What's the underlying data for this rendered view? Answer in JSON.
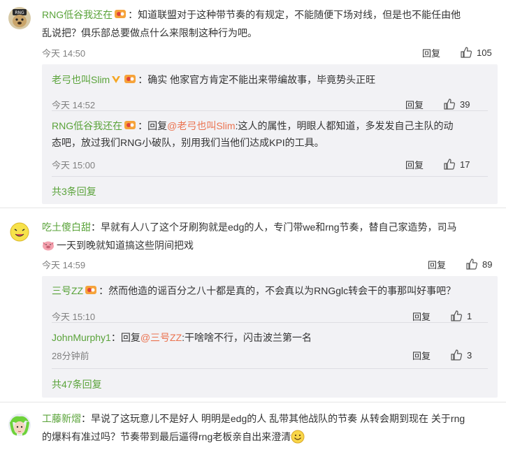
{
  "comments": [
    {
      "user": "RNG低谷我还在",
      "text_line1": "：知道联盟对于这种带节奏的有规定，不能随便下场对线，但是也不能任由他",
      "text_line2": "乱说把？俱乐部总要做点什么来限制这种行为吧。",
      "time": "今天 14:50",
      "reply_label": "回复",
      "likes": "105",
      "replies": [
        {
          "user": "老弓也叫Slim",
          "text": "：确实 他家官方肯定不能出来带编故事，毕竟势头正旺",
          "time": "今天 14:52",
          "reply_label": "回复",
          "likes": "39"
        },
        {
          "user": "RNG低谷我还在",
          "prefix": "：回复",
          "mention": "@老弓也叫Slim",
          "text_line1": ":这人的属性，明眼人都知道，多发发自己主队的动",
          "text_line2": "态吧，放过我们RNG小破队，别用我们当他们达成KPI的工具。",
          "time": "今天 15:00",
          "reply_label": "回复",
          "likes": "17"
        }
      ],
      "more_replies": "共3条回复"
    },
    {
      "user": "吃土傻白甜",
      "text_line1": "：早就有人八了这个牙刷狗就是edg的人，专门带we和rng节奏，替自己家造势，司马",
      "text_line2": "一天到晚就知道搞这些阴间把戏",
      "time": "今天 14:59",
      "reply_label": "回复",
      "likes": "89",
      "replies": [
        {
          "user": "三号ZZ",
          "text": "：然而他造的谣百分之八十都是真的，不会真以为RNGglc转会干的事那叫好事吧？",
          "time": "今天 15:10",
          "reply_label": "回复",
          "likes": "1"
        },
        {
          "user": "JohnMurphy1",
          "prefix": "：回复",
          "mention": "@三号ZZ",
          "text": ":干啥啥不行，闪击波兰第一名",
          "time": "28分钟前",
          "reply_label": "回复",
          "likes": "3"
        }
      ],
      "more_replies": "共47条回复"
    },
    {
      "user": "工藤新熠",
      "text_line1": "：早说了这玩意儿不是好人 明明是edg的人 乱带其他战队的节奏 从转会期到现在 关于rng",
      "text_line2": "的爆料有准过吗？节奏带到最后逼得rng老板亲自出来澄清"
    }
  ],
  "colors": {
    "username": "#5aa33a",
    "meta": "#808080",
    "sub_bg": "#f2f2f5",
    "mention": "#eb7350"
  }
}
